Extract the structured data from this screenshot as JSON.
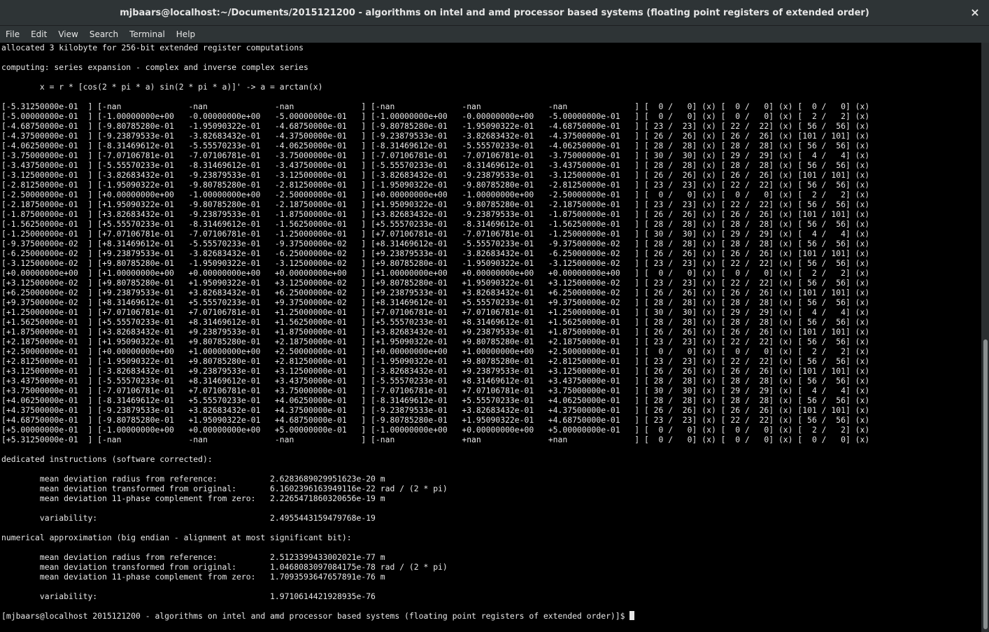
{
  "window": {
    "title": "mjbaars@localhost:~/Documents/2015121200 - algorithms on intel and amd processor based systems (floating point registers of extended order)",
    "close_icon": "×"
  },
  "menu": [
    "File",
    "Edit",
    "View",
    "Search",
    "Terminal",
    "Help"
  ],
  "terminal": {
    "lines": [
      "allocated 3 kilobyte for 256-bit extended register computations",
      "",
      "computing: series expansion - complex and inverse complex series",
      "",
      "        x = r * [cos(2 * pi * a) sin(2 * pi * a)]' -> a = arctan(x)",
      "",
      "[-5.31250000e-01  ] [-nan              -nan              -nan              ] [-nan              -nan              -nan              ] [  0 /   0] (x) [  0 /   0] (x) [  0 /   0] (x)",
      "[-5.00000000e-01  ] [-1.00000000e+00   -0.00000000e+00   -5.00000000e-01   ] [-1.00000000e+00   -0.00000000e+00   -5.00000000e-01   ] [  0 /   0] (x) [  0 /   0] (x) [  2 /   2] (x)",
      "[-4.68750000e-01  ] [-9.80785280e-01   -1.95090322e-01   -4.68750000e-01   ] [-9.80785280e-01   -1.95090322e-01   -4.68750000e-01   ] [ 23 /  23] (x) [ 22 /  22] (x) [ 56 /  56] (x)",
      "[-4.37500000e-01  ] [-9.23879533e-01   -3.82683432e-01   -4.37500000e-01   ] [-9.23879533e-01   -3.82683432e-01   -4.37500000e-01   ] [ 26 /  26] (x) [ 26 /  26] (x) [101 / 101] (x)",
      "[-4.06250000e-01  ] [-8.31469612e-01   -5.55570233e-01   -4.06250000e-01   ] [-8.31469612e-01   -5.55570233e-01   -4.06250000e-01   ] [ 28 /  28] (x) [ 28 /  28] (x) [ 56 /  56] (x)",
      "[-3.75000000e-01  ] [-7.07106781e-01   -7.07106781e-01   -3.75000000e-01   ] [-7.07106781e-01   -7.07106781e-01   -3.75000000e-01   ] [ 30 /  30] (x) [ 29 /  29] (x) [  4 /   4] (x)",
      "[-3.43750000e-01  ] [-5.55570233e-01   -8.31469612e-01   -3.43750000e-01   ] [-5.55570233e-01   -8.31469612e-01   -3.43750000e-01   ] [ 28 /  28] (x) [ 28 /  28] (x) [ 56 /  56] (x)",
      "[-3.12500000e-01  ] [-3.82683432e-01   -9.23879533e-01   -3.12500000e-01   ] [-3.82683432e-01   -9.23879533e-01   -3.12500000e-01   ] [ 26 /  26] (x) [ 26 /  26] (x) [101 / 101] (x)",
      "[-2.81250000e-01  ] [-1.95090322e-01   -9.80785280e-01   -2.81250000e-01   ] [-1.95090322e-01   -9.80785280e-01   -2.81250000e-01   ] [ 23 /  23] (x) [ 22 /  22] (x) [ 56 /  56] (x)",
      "[-2.50000000e-01  ] [+0.00000000e+00   -1.00000000e+00   -2.50000000e-01   ] [+0.00000000e+00   -1.00000000e+00   -2.50000000e-01   ] [  0 /   0] (x) [  0 /   0] (x) [  2 /   2] (x)",
      "[-2.18750000e-01  ] [+1.95090322e-01   -9.80785280e-01   -2.18750000e-01   ] [+1.95090322e-01   -9.80785280e-01   -2.18750000e-01   ] [ 23 /  23] (x) [ 22 /  22] (x) [ 56 /  56] (x)",
      "[-1.87500000e-01  ] [+3.82683432e-01   -9.23879533e-01   -1.87500000e-01   ] [+3.82683432e-01   -9.23879533e-01   -1.87500000e-01   ] [ 26 /  26] (x) [ 26 /  26] (x) [101 / 101] (x)",
      "[-1.56250000e-01  ] [+5.55570233e-01   -8.31469612e-01   -1.56250000e-01   ] [+5.55570233e-01   -8.31469612e-01   -1.56250000e-01   ] [ 28 /  28] (x) [ 28 /  28] (x) [ 56 /  56] (x)",
      "[-1.25000000e-01  ] [+7.07106781e-01   -7.07106781e-01   -1.25000000e-01   ] [+7.07106781e-01   -7.07106781e-01   -1.25000000e-01   ] [ 30 /  30] (x) [ 29 /  29] (x) [  4 /   4] (x)",
      "[-9.37500000e-02  ] [+8.31469612e-01   -5.55570233e-01   -9.37500000e-02   ] [+8.31469612e-01   -5.55570233e-01   -9.37500000e-02   ] [ 28 /  28] (x) [ 28 /  28] (x) [ 56 /  56] (x)",
      "[-6.25000000e-02  ] [+9.23879533e-01   -3.82683432e-01   -6.25000000e-02   ] [+9.23879533e-01   -3.82683432e-01   -6.25000000e-02   ] [ 26 /  26] (x) [ 26 /  26] (x) [101 / 101] (x)",
      "[-3.12500000e-02  ] [+9.80785280e-01   -1.95090322e-01   -3.12500000e-02   ] [+9.80785280e-01   -1.95090322e-01   -3.12500000e-02   ] [ 23 /  23] (x) [ 22 /  22] (x) [ 56 /  56] (x)",
      "[+0.00000000e+00  ] [+1.00000000e+00   +0.00000000e+00   +0.00000000e+00   ] [+1.00000000e+00   +0.00000000e+00   +0.00000000e+00   ] [  0 /   0] (x) [  0 /   0] (x) [  2 /   2] (x)",
      "[+3.12500000e-02  ] [+9.80785280e-01   +1.95090322e-01   +3.12500000e-02   ] [+9.80785280e-01   +1.95090322e-01   +3.12500000e-02   ] [ 23 /  23] (x) [ 22 /  22] (x) [ 56 /  56] (x)",
      "[+6.25000000e-02  ] [+9.23879533e-01   +3.82683432e-01   +6.25000000e-02   ] [+9.23879533e-01   +3.82683432e-01   +6.25000000e-02   ] [ 26 /  26] (x) [ 26 /  26] (x) [101 / 101] (x)",
      "[+9.37500000e-02  ] [+8.31469612e-01   +5.55570233e-01   +9.37500000e-02   ] [+8.31469612e-01   +5.55570233e-01   +9.37500000e-02   ] [ 28 /  28] (x) [ 28 /  28] (x) [ 56 /  56] (x)",
      "[+1.25000000e-01  ] [+7.07106781e-01   +7.07106781e-01   +1.25000000e-01   ] [+7.07106781e-01   +7.07106781e-01   +1.25000000e-01   ] [ 30 /  30] (x) [ 29 /  29] (x) [  4 /   4] (x)",
      "[+1.56250000e-01  ] [+5.55570233e-01   +8.31469612e-01   +1.56250000e-01   ] [+5.55570233e-01   +8.31469612e-01   +1.56250000e-01   ] [ 28 /  28] (x) [ 28 /  28] (x) [ 56 /  56] (x)",
      "[+1.87500000e-01  ] [+3.82683432e-01   +9.23879533e-01   +1.87500000e-01   ] [+3.82683432e-01   +9.23879533e-01   +1.87500000e-01   ] [ 26 /  26] (x) [ 26 /  26] (x) [101 / 101] (x)",
      "[+2.18750000e-01  ] [+1.95090322e-01   +9.80785280e-01   +2.18750000e-01   ] [+1.95090322e-01   +9.80785280e-01   +2.18750000e-01   ] [ 23 /  23] (x) [ 22 /  22] (x) [ 56 /  56] (x)",
      "[+2.50000000e-01  ] [+0.00000000e+00   +1.00000000e+00   +2.50000000e-01   ] [+0.00000000e+00   +1.00000000e+00   +2.50000000e-01   ] [  0 /   0] (x) [  0 /   0] (x) [  2 /   2] (x)",
      "[+2.81250000e-01  ] [-1.95090322e-01   +9.80785280e-01   +2.81250000e-01   ] [-1.95090322e-01   +9.80785280e-01   +2.81250000e-01   ] [ 23 /  23] (x) [ 22 /  22] (x) [ 56 /  56] (x)",
      "[+3.12500000e-01  ] [-3.82683432e-01   +9.23879533e-01   +3.12500000e-01   ] [-3.82683432e-01   +9.23879533e-01   +3.12500000e-01   ] [ 26 /  26] (x) [ 26 /  26] (x) [101 / 101] (x)",
      "[+3.43750000e-01  ] [-5.55570233e-01   +8.31469612e-01   +3.43750000e-01   ] [-5.55570233e-01   +8.31469612e-01   +3.43750000e-01   ] [ 28 /  28] (x) [ 28 /  28] (x) [ 56 /  56] (x)",
      "[+3.75000000e-01  ] [-7.07106781e-01   +7.07106781e-01   +3.75000000e-01   ] [-7.07106781e-01   +7.07106781e-01   +3.75000000e-01   ] [ 30 /  30] (x) [ 29 /  29] (x) [  4 /   4] (x)",
      "[+4.06250000e-01  ] [-8.31469612e-01   +5.55570233e-01   +4.06250000e-01   ] [-8.31469612e-01   +5.55570233e-01   +4.06250000e-01   ] [ 28 /  28] (x) [ 28 /  28] (x) [ 56 /  56] (x)",
      "[+4.37500000e-01  ] [-9.23879533e-01   +3.82683432e-01   +4.37500000e-01   ] [-9.23879533e-01   +3.82683432e-01   +4.37500000e-01   ] [ 26 /  26] (x) [ 26 /  26] (x) [101 / 101] (x)",
      "[+4.68750000e-01  ] [-9.80785280e-01   +1.95090322e-01   +4.68750000e-01   ] [-9.80785280e-01   +1.95090322e-01   +4.68750000e-01   ] [ 23 /  23] (x) [ 22 /  22] (x) [ 56 /  56] (x)",
      "[+5.00000000e-01  ] [-1.00000000e+00   +0.00000000e+00   +5.00000000e-01   ] [-1.00000000e+00   +0.00000000e+00   +5.00000000e-01   ] [  0 /   0] (x) [  0 /   0] (x) [  2 /   2] (x)",
      "[+5.31250000e-01  ] [-nan              -nan              -nan              ] [-nan              +nan              +nan              ] [  0 /   0] (x) [  0 /   0] (x) [  0 /   0] (x)",
      "",
      "dedicated instructions (software corrected):",
      "",
      "        mean deviation radius from reference:           2.6283689029951623e-20 m",
      "        mean deviation transformed from original:       6.1602396163949116e-22 rad / (2 * pi)",
      "        mean deviation 11-phase complement from zero:   2.2265471860320656e-19 m",
      "",
      "        variability:                                    2.4955443159479768e-19",
      "",
      "numerical approximation (big endian - alignment at most significant bit):",
      "",
      "        mean deviation radius from reference:           2.5123399433002021e-77 m",
      "        mean deviation transformed from original:       1.0468083097084175e-78 rad / (2 * pi)",
      "        mean deviation 11-phase complement from zero:   1.7093593647657891e-76 m",
      "",
      "        variability:                                    1.9710614421928935e-76",
      ""
    ],
    "prompt": "[mjbaars@localhost 2015121200 - algorithms on intel and amd processor based systems (floating point registers of extended order)]$ "
  }
}
